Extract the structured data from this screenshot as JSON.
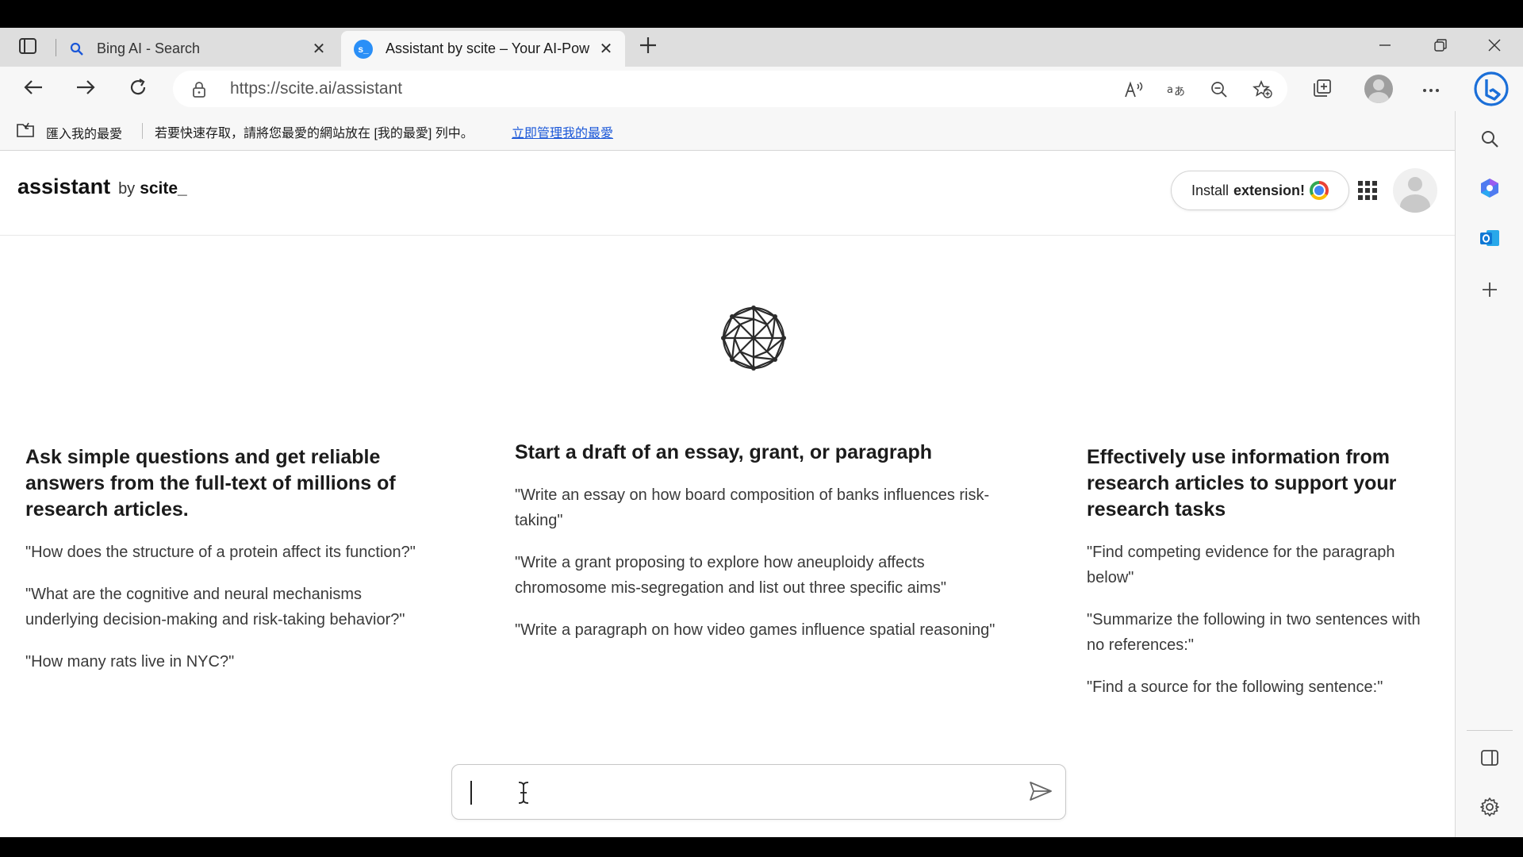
{
  "tabs": [
    {
      "title": "Bing AI - Search",
      "icon": "search-icon"
    },
    {
      "title": "Assistant by scite – Your AI-Powe",
      "icon": "scite-favicon",
      "favicon_text": "s_"
    }
  ],
  "address_bar": {
    "url": "https://scite.ai/assistant"
  },
  "favorites_bar": {
    "import_label": "匯入我的最愛",
    "hint": "若要快速存取，請將您最愛的網站放在 [我的最愛] 列中。",
    "manage_link": "立即管理我的最愛"
  },
  "header": {
    "brand": "assistant",
    "by": "by",
    "company": "scite_",
    "install_label": "Install",
    "install_bold": "extension!"
  },
  "columns": [
    {
      "title": "Ask simple questions and get reliable answers from the full-text of millions of research articles.",
      "prompts": [
        "\"How does the structure of a protein affect its function?\"",
        "\"What are the cognitive and neural mechanisms underlying decision-making and risk-taking behavior?\"",
        "\"How many rats live in NYC?\""
      ]
    },
    {
      "title": "Start a draft of an essay, grant, or paragraph",
      "prompts": [
        "\"Write an essay on how board composition of banks influences risk-taking\"",
        "\"Write a grant proposing to explore how aneuploidy affects chromosome mis-segregation and list out three specific aims\"",
        "\"Write a paragraph on how video games influence spatial reasoning\""
      ]
    },
    {
      "title": "Effectively use information from research articles to support your research tasks",
      "prompts": [
        "\"Find competing evidence for the paragraph below\"",
        "\"Summarize the following in two sentences with no references:\"",
        "\"Find a source for the following sentence:\""
      ]
    }
  ],
  "chat": {
    "value": "",
    "placeholder": ""
  },
  "colors": {
    "accent": "#1a57d8",
    "scite_blue": "#2a8ff7",
    "outlook_blue": "#0f78d4",
    "copilot_blue": "#1b6fd8"
  }
}
